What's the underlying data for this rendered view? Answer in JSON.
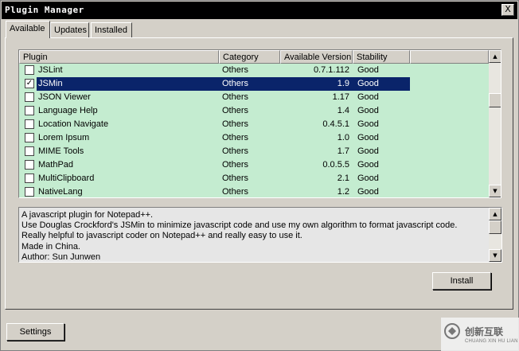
{
  "window": {
    "title": "Plugin Manager",
    "close_label": "X"
  },
  "tabs": [
    {
      "label": "Available",
      "active": true
    },
    {
      "label": "Updates",
      "active": false
    },
    {
      "label": "Installed",
      "active": false
    }
  ],
  "columns": [
    "Plugin",
    "Category",
    "Available Version",
    "Stability"
  ],
  "plugins": [
    {
      "name": "JSLint",
      "category": "Others",
      "version": "0.7.1.112",
      "stability": "Good",
      "checked": false,
      "selected": false
    },
    {
      "name": "JSMin",
      "category": "Others",
      "version": "1.9",
      "stability": "Good",
      "checked": true,
      "selected": true
    },
    {
      "name": "JSON Viewer",
      "category": "Others",
      "version": "1.17",
      "stability": "Good",
      "checked": false,
      "selected": false
    },
    {
      "name": "Language Help",
      "category": "Others",
      "version": "1.4",
      "stability": "Good",
      "checked": false,
      "selected": false
    },
    {
      "name": "Location Navigate",
      "category": "Others",
      "version": "0.4.5.1",
      "stability": "Good",
      "checked": false,
      "selected": false
    },
    {
      "name": "Lorem Ipsum",
      "category": "Others",
      "version": "1.0",
      "stability": "Good",
      "checked": false,
      "selected": false
    },
    {
      "name": "MIME Tools",
      "category": "Others",
      "version": "1.7",
      "stability": "Good",
      "checked": false,
      "selected": false
    },
    {
      "name": "MathPad",
      "category": "Others",
      "version": "0.0.5.5",
      "stability": "Good",
      "checked": false,
      "selected": false
    },
    {
      "name": "MultiClipboard",
      "category": "Others",
      "version": "2.1",
      "stability": "Good",
      "checked": false,
      "selected": false
    },
    {
      "name": "NativeLang",
      "category": "Others",
      "version": "1.2",
      "stability": "Good",
      "checked": false,
      "selected": false
    }
  ],
  "description": [
    "A javascript plugin for Notepad++.",
    "Use Douglas Crockford's JSMin to minimize javascript code and use my own algorithm to format javascript code.",
    "Really helpful to javascript coder on Notepad++ and really easy to use it.",
    "Made in China.",
    "Author: Sun Junwen"
  ],
  "buttons": {
    "install": "Install",
    "settings": "Settings"
  },
  "watermark": {
    "text": "创新互联",
    "sub": "CHUANG XIN HU LIAN"
  },
  "colors": {
    "list_bg": "#c4ecd0",
    "selection": "#0a246a",
    "dialog_bg": "#d4d0c8"
  }
}
